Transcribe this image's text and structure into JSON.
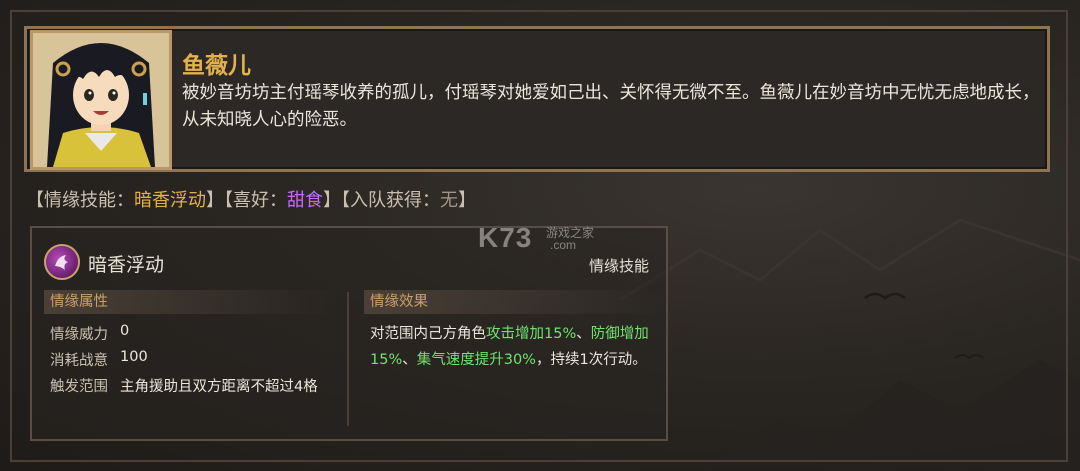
{
  "character": {
    "name": "鱼薇儿",
    "description": "被妙音坊坊主付瑶琴收养的孤儿，付瑶琴对她爱如己出、关怀得无微不至。鱼薇儿在妙音坊中无忧无虑地成长，从未知晓人心的险恶。"
  },
  "summary": {
    "skill_open": "【情缘技能：",
    "skill_value": "暗香浮动",
    "skill_close": "】",
    "hobby_open": "【喜好：",
    "hobby_value": "甜食",
    "hobby_close": "】",
    "join_open": "【入队获得：",
    "join_value": "无",
    "join_close": "】"
  },
  "skill": {
    "name": "暗香浮动",
    "type": "情缘技能",
    "attributes_header": "情缘属性",
    "effect_header": "情缘效果",
    "attributes": [
      {
        "label": "情缘威力",
        "value": "0"
      },
      {
        "label": "消耗战意",
        "value": "100"
      },
      {
        "label": "触发范围",
        "value": "主角援助且双方距离不超过4格"
      }
    ],
    "effect": {
      "part1": "对范围内己方角色",
      "highlight1": "攻击增加15%",
      "part2": "、",
      "highlight2": "防御增加15%",
      "part3": "、",
      "highlight3": "集气速度提升30%",
      "part4": "，持续1次行动。"
    }
  },
  "watermark": {
    "logo": "K73",
    "sub1": "游戏之家",
    "sub2": ".com"
  },
  "colors": {
    "gold": "#e3b24a",
    "purple": "#c36bff",
    "green": "#6fe36f",
    "frame": "#8e7454"
  }
}
